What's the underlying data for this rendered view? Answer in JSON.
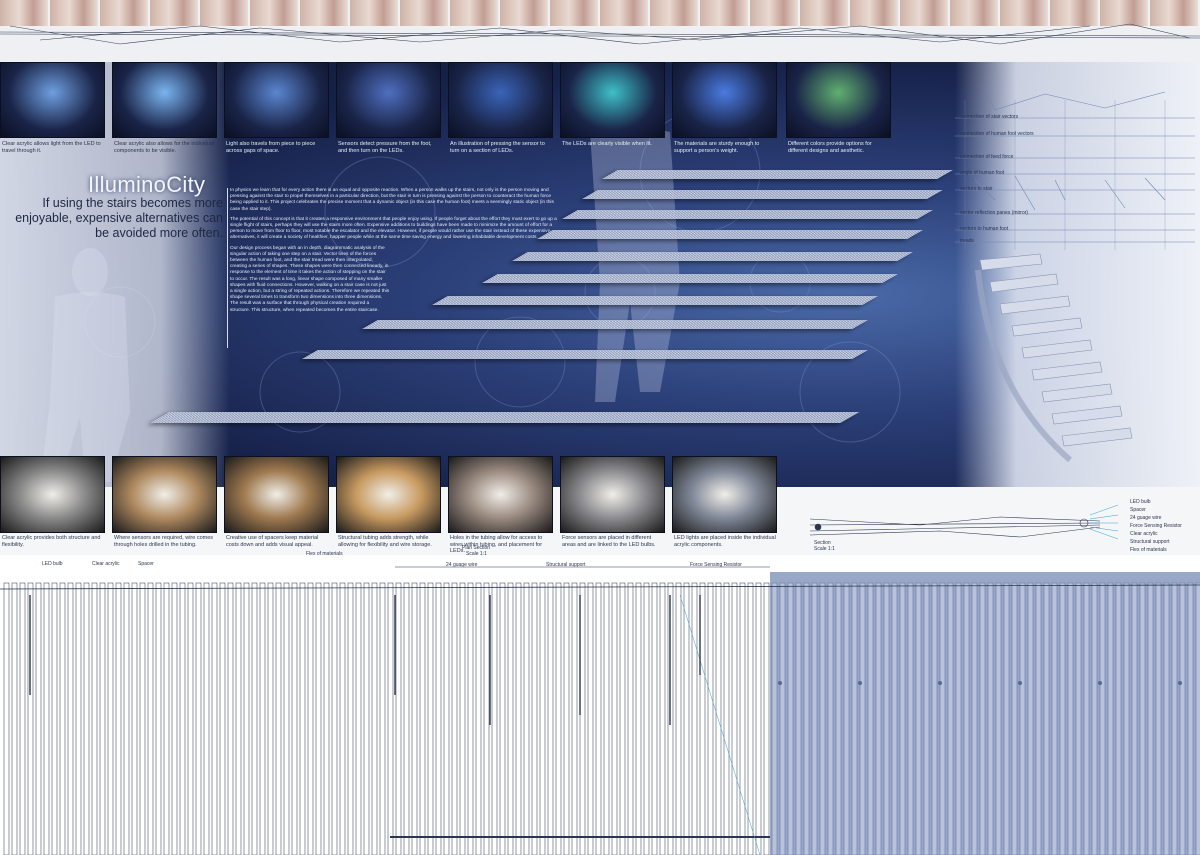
{
  "title": "IlluminoCity",
  "subtitle": "If using the stairs becomes more enjoyable, expensive alternatives can be avoided more often.",
  "body_paragraphs": [
    "In physics we learn that for every action there is an equal and opposite reaction. When a person walks up the stairs, not only is the person moving and pressing against the stair to propel themselves in a particular direction, but the stair in turn is pressing against the person to counteract the human force being applied to it. This project celebrates the precise moment that a dynamic object (in this case the human foot) meets a seemingly static object (in this case the stair step).",
    "The potential of this concept is that it creates a responsive environment that people enjoy using. If people forget about the effort they must exert to go up a single flight of stairs, perhaps they will use the stairs more often. Expensive additions to buildings have been made to minimize the amount of effort for a person to move from floor to floor, most notable the escalator and the elevator. However, if people would rather use the stair instead of these expensive alternatives, it will create a society of healthier, happier people while at the same time saving energy and lowering inhabitable development costs.",
    "Our design process began with an in depth, diagrammatic analysis of the singular action of taking one step on a stair. Vector lines of the forces between the human foot, and the stair tread were then interpolated, creating a series of shapes. These shapes were then connected linearly, in response to the element of time it takes the action of stepping on the stair to occur. The result was a long, linear shape composed of many smaller shapes with fluid connections. However, walking on a stair case is not just a single action, but a string of repeated actions. Therefore we repeated this shape several times to transform two dimensions into three dimensions. The result was a surface that through physical creation required a structure. This structure, when repeated becomes the entire staircase."
  ],
  "top_photos": [
    {
      "caption": "Clear acrylic allows light from the LED to travel through it.",
      "tone": "#6f9fe0"
    },
    {
      "caption": "Clear acrylic also allows for the individual components to be visible.",
      "tone": "#7ab4f0"
    },
    {
      "caption": "Light also travels from piece to piece across gaps of space.",
      "tone": "#5a86d0"
    },
    {
      "caption": "Sensors detect pressure from the foot, and then turn on the LEDs.",
      "tone": "#4f6fc0"
    },
    {
      "caption": "An illustration of pressing the sensor to turn on a section of LEDs.",
      "tone": "#3a64b8"
    },
    {
      "caption": "The LEDs are clearly visible when lit.",
      "tone": "#3ec0c8"
    },
    {
      "caption": "The materials are sturdy enough to support a person's weight.",
      "tone": "#4a7be0"
    },
    {
      "caption": "Different colors provide options for different designs and aesthetic.",
      "tone": "#60b070"
    }
  ],
  "bottom_photos": [
    {
      "caption": "Clear acrylic provides both structure and flexibility.",
      "tone": "#8a8a8a"
    },
    {
      "caption": "Where sensors are required, wire comes through holes drilled in the tubing.",
      "tone": "#b08a60"
    },
    {
      "caption": "Creative use of spacers keep material costs down and adds visual appeal.",
      "tone": "#a07a50"
    },
    {
      "caption": "Structural tubing adds strength, while allowing for flexibility and wire storage.",
      "tone": "#c89a60"
    },
    {
      "caption": "Holes in the tubing allow for access to wires within tubing, and placement for LEDs.",
      "tone": "#9a8a80"
    },
    {
      "caption": "Force sensors are placed in different areas and are linked to the LED bulbs.",
      "tone": "#8c8c90"
    },
    {
      "caption": "LED lights are placed inside the individual acrylic components.",
      "tone": "#808898"
    }
  ],
  "vector_labels": [
    "connection of stair vectors",
    "connection of human foot vectors",
    "connection of feed force",
    "angle of human foot",
    "vectors to stair",
    "vector reflection panes (mirror)",
    "vectors to human foot",
    "treads"
  ],
  "section": {
    "title": "Section",
    "scale": "Scale 1:1",
    "labels": [
      "LED bulb",
      "Spacer",
      "24 guage wire",
      "Force Sensing Resistor",
      "Clear acrylic",
      "Structural support",
      "Flex of materials"
    ]
  },
  "plan": {
    "title": "Plan Section",
    "scale": "Scale 1:1",
    "labels": [
      "LED bulb",
      "Clear acrylic",
      "Spacer",
      "Flex of materials",
      "24 guage wire",
      "Structural support",
      "Force Sensing Resistor"
    ]
  },
  "colors": {
    "panel_dark": "#17224a",
    "panel_mid": "#2b3f78",
    "accent_blue": "#9aa8c8"
  }
}
